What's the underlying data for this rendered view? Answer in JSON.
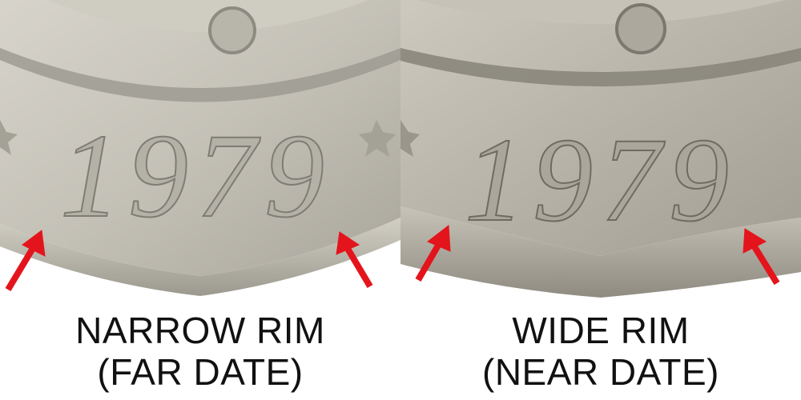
{
  "panels": [
    {
      "date_text": "1979",
      "caption_line1": "NARROW RIM",
      "caption_line2": "(FAR DATE)"
    },
    {
      "date_text": "1979",
      "caption_line1": "WIDE RIM",
      "caption_line2": "(NEAR DATE)"
    }
  ],
  "colors": {
    "arrow": "#e4141c",
    "caption_text": "#111111",
    "coin_left": "#c9c6bc",
    "coin_right": "#b9b5aa"
  },
  "icons": [
    "star-icon",
    "red-arrow-icon"
  ]
}
